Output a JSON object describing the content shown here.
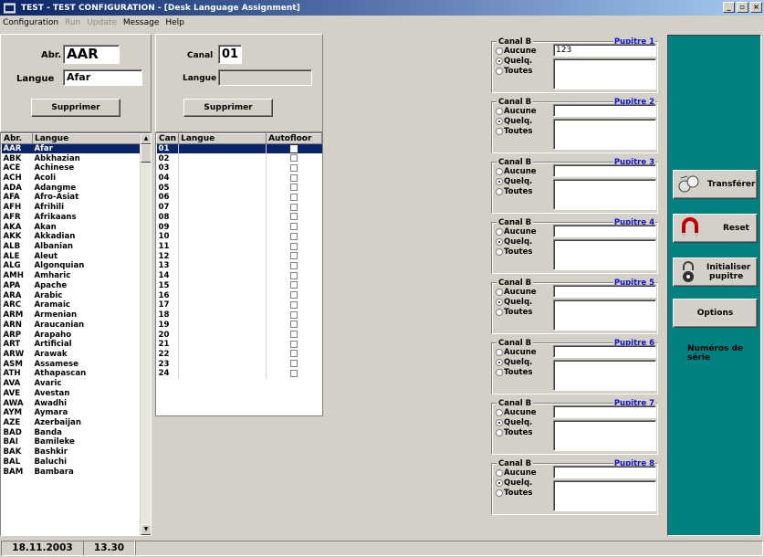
{
  "window": {
    "title": "TEST - TEST CONFIGURATION - [Desk Language Assignment]",
    "controls": [
      "_",
      "▫",
      "×"
    ]
  },
  "menu": [
    {
      "label": "Configuration",
      "enabled": true
    },
    {
      "label": "Run",
      "enabled": false
    },
    {
      "label": "Update",
      "enabled": false
    },
    {
      "label": "Message",
      "enabled": true
    },
    {
      "label": "Help",
      "enabled": true
    }
  ],
  "left": {
    "abr_label": "Abr.",
    "abr_value": "AAR",
    "langue_label": "Langue",
    "langue_value": "Afar",
    "delete_label": "Supprimer",
    "columns": [
      "Abr.",
      "Langue"
    ],
    "rows": [
      [
        "AAR",
        "Afar"
      ],
      [
        "ABK",
        "Abkhazian"
      ],
      [
        "ACE",
        "Achinese"
      ],
      [
        "ACH",
        "Acoli"
      ],
      [
        "ADA",
        "Adangme"
      ],
      [
        "AFA",
        "Afro-Asiat"
      ],
      [
        "AFH",
        "Afrihili"
      ],
      [
        "AFR",
        "Afrikaans"
      ],
      [
        "AKA",
        "Akan"
      ],
      [
        "AKK",
        "Akkadian"
      ],
      [
        "ALB",
        "Albanian"
      ],
      [
        "ALE",
        "Aleut"
      ],
      [
        "ALG",
        "Algonquian"
      ],
      [
        "AMH",
        "Amharic"
      ],
      [
        "APA",
        "Apache"
      ],
      [
        "ARA",
        "Arabic"
      ],
      [
        "ARC",
        "Aramaic"
      ],
      [
        "ARM",
        "Armenian"
      ],
      [
        "ARN",
        "Araucanian"
      ],
      [
        "ARP",
        "Arapaho"
      ],
      [
        "ART",
        "Artificial"
      ],
      [
        "ARW",
        "Arawak"
      ],
      [
        "ASM",
        "Assamese"
      ],
      [
        "ATH",
        "Athapascan"
      ],
      [
        "AVA",
        "Avaric"
      ],
      [
        "AVE",
        "Avestan"
      ],
      [
        "AWA",
        "Awadhi"
      ],
      [
        "AYM",
        "Aymara"
      ],
      [
        "AZE",
        "Azerbaijan"
      ],
      [
        "BAD",
        "Banda"
      ],
      [
        "BAI",
        "Bamileke"
      ],
      [
        "BAK",
        "Bashkir"
      ],
      [
        "BAL",
        "Baluchi"
      ],
      [
        "BAM",
        "Bambara"
      ]
    ]
  },
  "middle": {
    "canal_label": "Canal",
    "canal_value": "01",
    "langue_label": "Langue",
    "langue_value": "",
    "delete_label": "Supprimer",
    "columns": [
      "Can",
      "Langue",
      "Autofloor"
    ],
    "rows": [
      "01",
      "02",
      "03",
      "04",
      "05",
      "06",
      "07",
      "08",
      "09",
      "10",
      "11",
      "12",
      "13",
      "14",
      "15",
      "16",
      "17",
      "18",
      "19",
      "20",
      "21",
      "22",
      "23",
      "24"
    ]
  },
  "canal_groups": {
    "group_label": "Canal B",
    "options": [
      "Aucune",
      "Quelq.",
      "Toutes"
    ],
    "selected": "Quelq.",
    "desks": [
      {
        "pupitre": "Pupitre  1",
        "value": "123"
      },
      {
        "pupitre": "Pupitre  2",
        "value": ""
      },
      {
        "pupitre": "Pupitre  3",
        "value": ""
      },
      {
        "pupitre": "Pupitre  4",
        "value": ""
      },
      {
        "pupitre": "Pupitre  5",
        "value": ""
      },
      {
        "pupitre": "Pupitre  6",
        "value": ""
      },
      {
        "pupitre": "Pupitre  7",
        "value": ""
      },
      {
        "pupitre": "Pupitre  8",
        "value": ""
      }
    ]
  },
  "sidebar": {
    "transfer": "Transférer",
    "reset": "Reset",
    "init_line1": "Initialiser",
    "init_line2": "pupitre",
    "options": "Options",
    "serial_line1": "Numéros de",
    "serial_line2": "série"
  },
  "status": {
    "date": "18.11.2003",
    "time": "13.30"
  },
  "colors": {
    "selection": "#0a246a",
    "sidebar": "#008080",
    "pupitre_text": "#1010d0"
  }
}
